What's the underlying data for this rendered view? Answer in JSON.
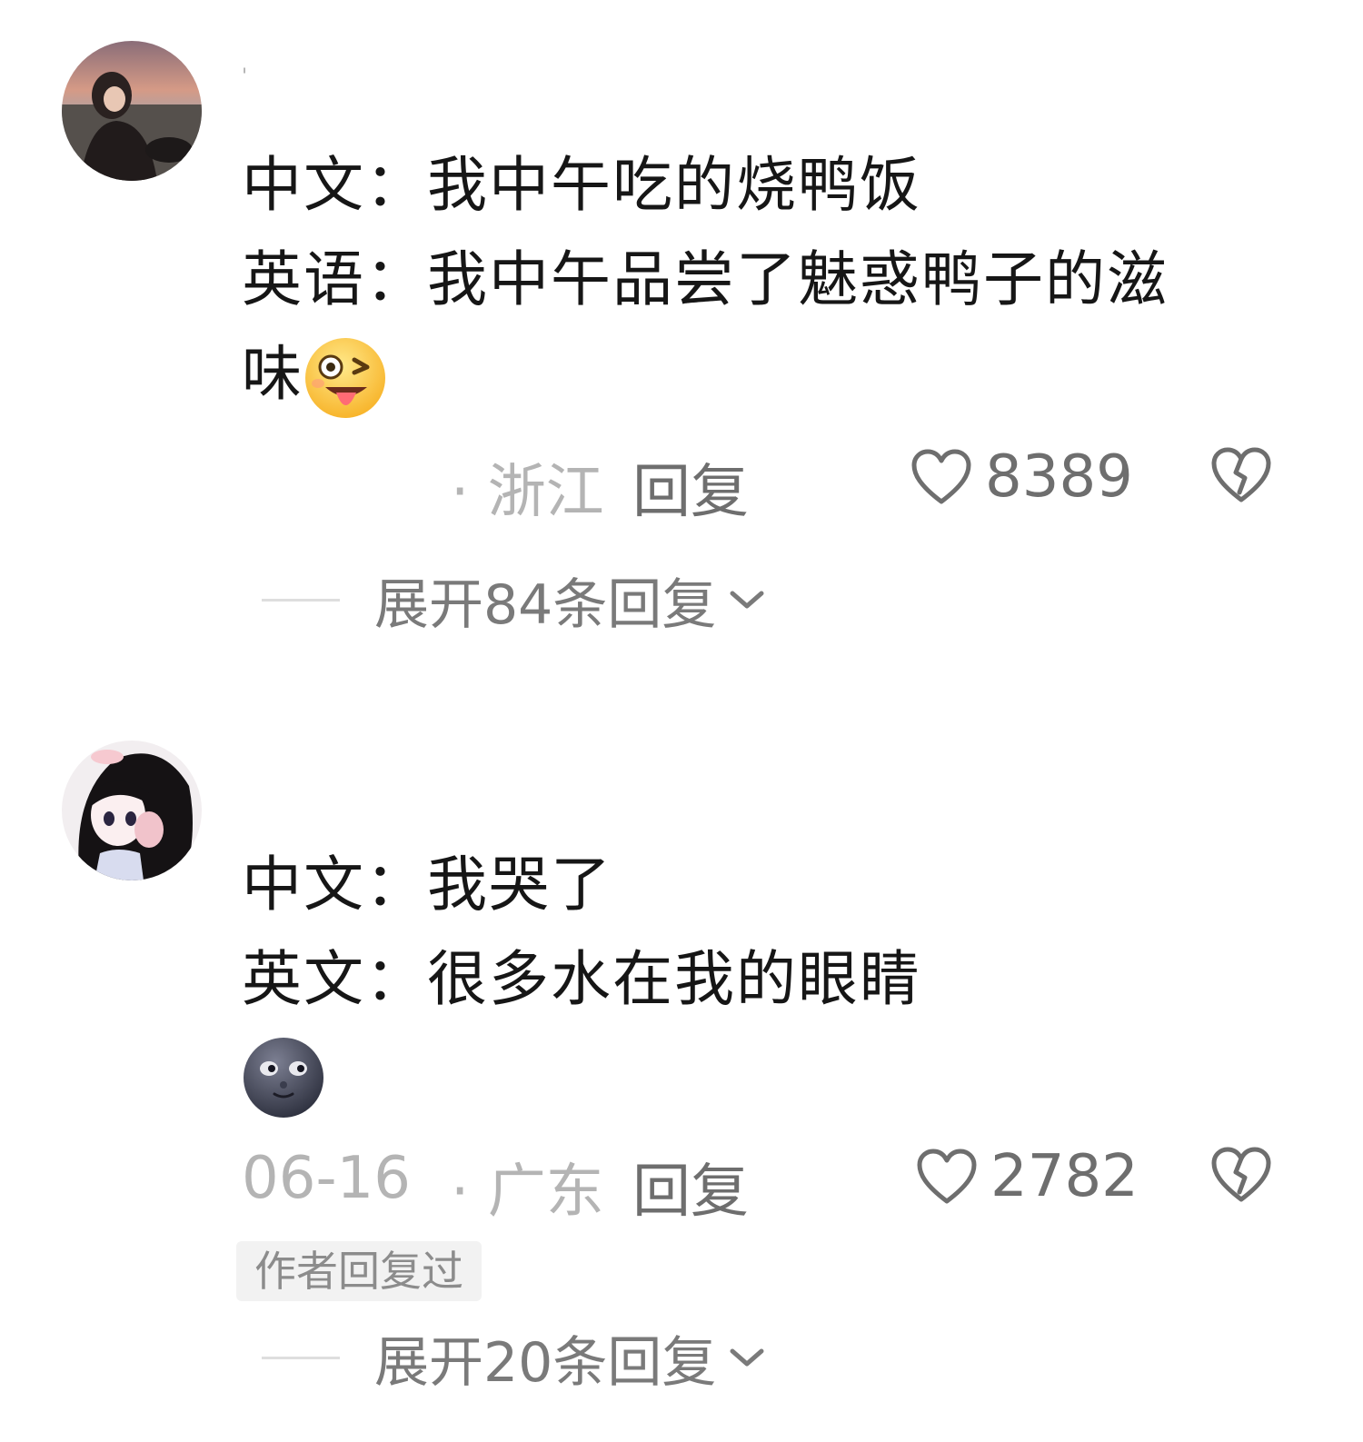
{
  "comments": [
    {
      "username": "'",
      "lines": [
        "中文：我中午吃的烧鸭饭",
        "英语：我中午品尝了魅惑鸭子的滋",
        "味"
      ],
      "emoji": "winking-face-with-tongue",
      "date": "",
      "location": "· 浙江",
      "reply_label": "回复",
      "likes": "8389",
      "author_replied": "",
      "expand_label": "展开84条回复"
    },
    {
      "username": "",
      "lines": [
        "中文：我哭了",
        "英文：很多水在我的眼睛"
      ],
      "emoji": "new-moon-face",
      "date": "06-16",
      "location": "· 广东",
      "reply_label": "回复",
      "likes": "2782",
      "author_replied": "作者回复过",
      "expand_label": "展开20条回复"
    }
  ],
  "colors": {
    "text": "#161616",
    "meta": "#b4b4b4",
    "action": "#6e6e6e",
    "badge_bg": "#f2f2f2"
  },
  "icons": {
    "like": "heart-outline-icon",
    "dislike": "broken-heart-icon",
    "expand": "chevron-down-icon"
  }
}
